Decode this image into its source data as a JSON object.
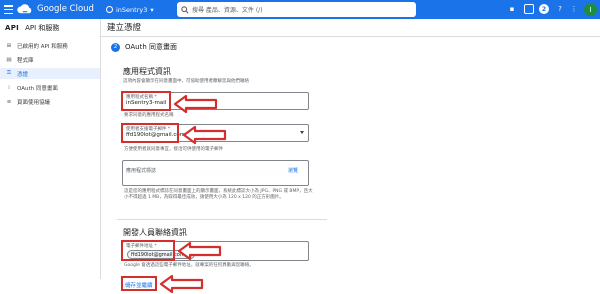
{
  "topbar": {
    "brand": "Google Cloud",
    "project": "inSentry3",
    "search_placeholder": "搜尋 產品、資源、文件 (/)",
    "notification_count": "2",
    "avatar_initial": "I"
  },
  "sidebar": {
    "api_label": "API",
    "title": "API 和服務",
    "items": [
      {
        "label": "已啟用的 API 和服務",
        "icon": "grid-icon"
      },
      {
        "label": "程式庫",
        "icon": "library-icon"
      },
      {
        "label": "憑證",
        "icon": "key-icon"
      },
      {
        "label": "OAuth 同意畫面",
        "icon": "consent-icon"
      },
      {
        "label": "頁面使用協議",
        "icon": "settings-icon"
      }
    ]
  },
  "main": {
    "title": "建立憑證",
    "step_number": "2",
    "step_title": "OAuth 同意畫面",
    "app_info": {
      "title": "應用程式資訊",
      "description": "這項內容會顯示在同意畫面中，可協助使用者瞭解您與他們聯絡",
      "app_name_label": "應用程式名稱 *",
      "app_name_value": "inSentry3-mail",
      "app_name_helper": "要求同意的應用程式名稱",
      "support_email_label": "使用者支援電子郵件 *",
      "support_email_value": "ffd190lot@gmail.com",
      "support_email_helper": "方便使用者就同意事宜，接洽可供使用的電子郵件",
      "logo_label": "應用程式標誌",
      "logo_action": "瀏覽",
      "logo_helper": "這是您的應用程式標誌在同意畫面上的顯示畫面，系統此標誌大小為 JPG、PNG 或 BMP，且大小不得超過 1 MB，為取得最佳成效，請使用大小為 120 x 120 的正方形圖片。"
    },
    "developer": {
      "title": "開發人員聯絡資訊",
      "email_label": "電子郵件地址 *",
      "email_chip": "ffd190lot@gmail.com",
      "helper": "Google 會透過這些電子郵件地址，就專案的任何異動與您聯絡。",
      "save_button": "儲存並繼續"
    }
  },
  "colors": {
    "accent": "#1a73e8",
    "highlight": "#d32f2f"
  }
}
